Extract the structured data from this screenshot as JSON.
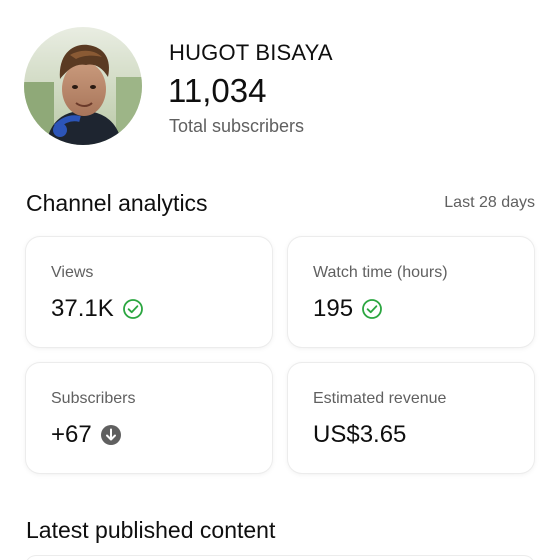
{
  "channel": {
    "name": "HUGOT BISAYA",
    "subscriber_count": "11,034",
    "subscriber_label": "Total subscribers",
    "avatar_icon": "channel-avatar-photo"
  },
  "analytics": {
    "title": "Channel analytics",
    "period": "Last 28 days",
    "cards": [
      {
        "label": "Views",
        "value": "37.1K",
        "status_icon": "check-circle-icon",
        "status_color": "#2ba640"
      },
      {
        "label": "Watch time (hours)",
        "value": "195",
        "status_icon": "check-circle-icon",
        "status_color": "#2ba640"
      },
      {
        "label": "Subscribers",
        "value": "+67",
        "status_icon": "arrow-down-circle-icon",
        "status_color": "#606060"
      },
      {
        "label": "Estimated revenue",
        "value": "US$3.65",
        "status_icon": "",
        "status_color": ""
      }
    ]
  },
  "latest": {
    "title": "Latest published content"
  }
}
